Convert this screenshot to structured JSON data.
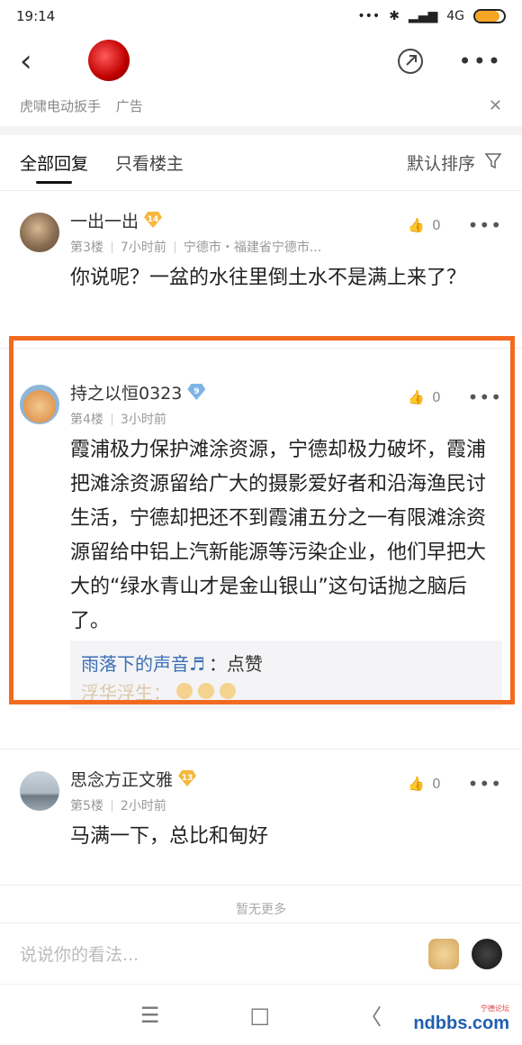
{
  "status": {
    "time": "19:14",
    "dots": "•••",
    "network": "4G",
    "battery_level": 0.85
  },
  "nav": {
    "share_icon": "share-icon",
    "more": "•••"
  },
  "ad": {
    "text": "虎啸电动扳手",
    "tag": "广告",
    "close": "✕"
  },
  "tabs": {
    "all": "全部回复",
    "owner_only": "只看楼主",
    "sort": "默认排序"
  },
  "posts": [
    {
      "name": "一出一出",
      "level": "14",
      "floor": "第3楼",
      "time": "7小时前",
      "location": "宁德市・福建省宁德市...",
      "likes": "0",
      "body": "你说呢？一盆的水往里倒土水不是满上来了？"
    },
    {
      "name": "持之以恒0323",
      "level": "9",
      "floor": "第4楼",
      "time": "3小时前",
      "likes": "0",
      "body": "霞浦极力保护滩涂资源，宁德却极力破坏，霞浦把滩涂资源留给广大的摄影爱好者和沿海渔民讨生活，宁德却把还不到霞浦五分之一有限滩涂资源留给中铝上汽新能源等污染企业，他们早把大大的“绿水青山才是金山银山”这句话抛之脑后了。",
      "sub_replies": [
        {
          "user": "雨落下的声音♬",
          "text": "：点赞"
        },
        {
          "user": "浮华浮生：",
          "text": ""
        }
      ]
    },
    {
      "name": "思念方正文雅",
      "level": "13",
      "floor": "第5楼",
      "time": "2小时前",
      "likes": "0",
      "body": "马满一下，总比和甸好"
    }
  ],
  "no_more": "暂无更多",
  "input": {
    "placeholder": "说说你的看法..."
  },
  "sys_nav": {
    "menu": "☰",
    "home": "□",
    "back": "〈"
  },
  "watermark": {
    "main": "ndbbs.com",
    "sub": "宁德论坛"
  }
}
